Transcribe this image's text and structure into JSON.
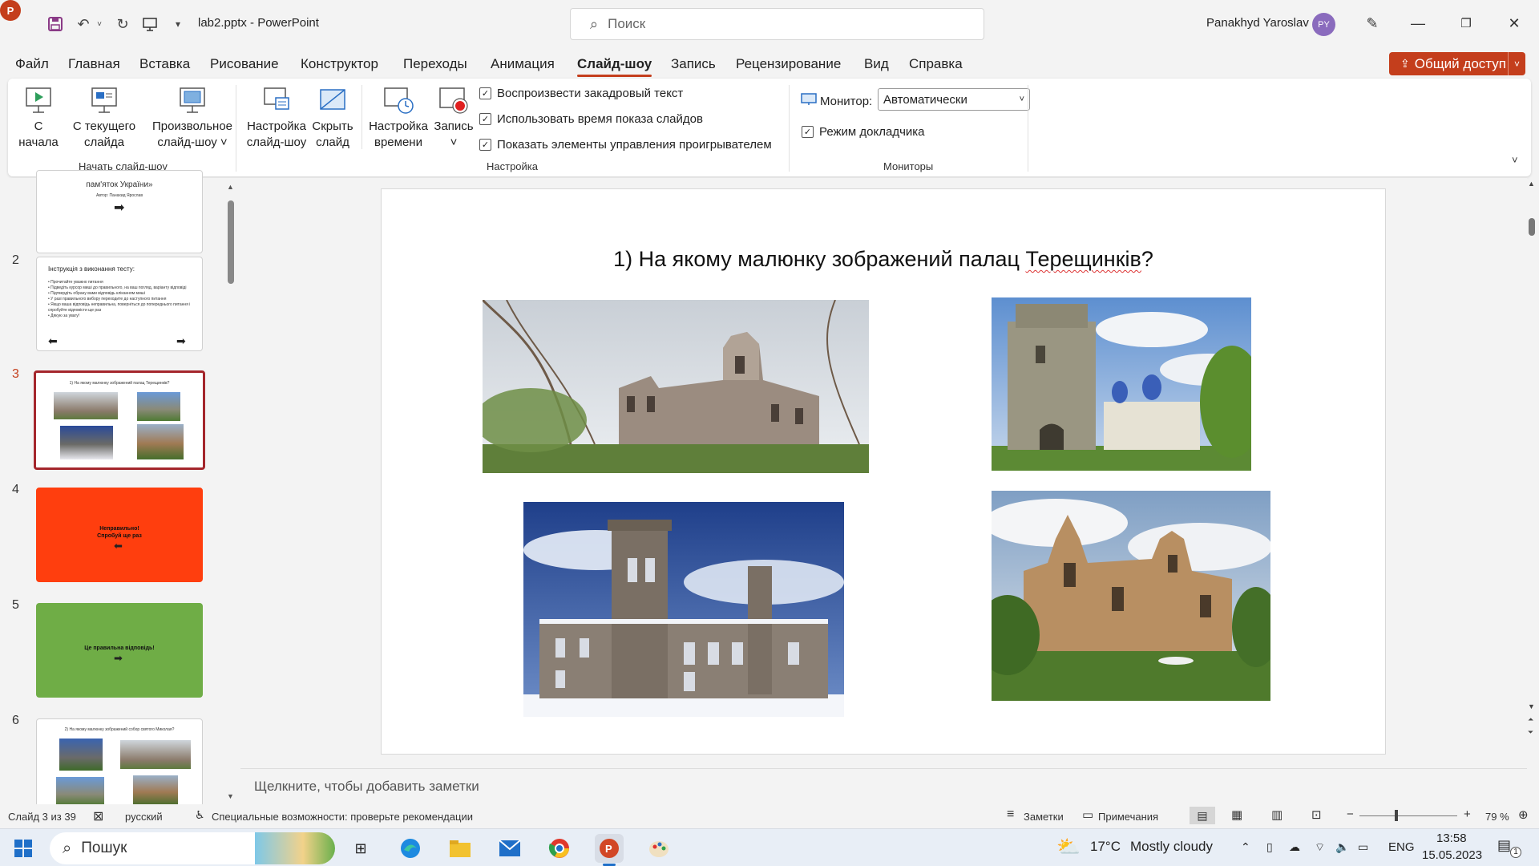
{
  "window": {
    "app_icon": "powerpoint-icon",
    "doc_title": "lab2.pptx  -  PowerPoint",
    "search_placeholder": "Поиск",
    "user_name": "Panakhyd Yaroslav",
    "user_initials": "PY"
  },
  "menu": {
    "tabs": [
      "Файл",
      "Главная",
      "Вставка",
      "Рисование",
      "Конструктор",
      "Переходы",
      "Анимация",
      "Слайд-шоу",
      "Запись",
      "Рецензирование",
      "Вид",
      "Справка"
    ],
    "active_tab": "Слайд-шоу",
    "share_label": "Общий доступ"
  },
  "ribbon": {
    "start_group": {
      "label": "Начать слайд-шоу",
      "from_start": [
        "С",
        "начала"
      ],
      "from_current": [
        "С текущего",
        "слайда"
      ],
      "custom": [
        "Произвольное",
        "слайд-шоу ˅"
      ]
    },
    "setup_group": {
      "label": "Настройка",
      "setup_show": [
        "Настройка",
        "слайд-шоу"
      ],
      "hide_slide": [
        "Скрыть",
        "слайд"
      ],
      "rehearse": [
        "Настройка",
        "времени"
      ],
      "record": [
        "Запись",
        "˅"
      ],
      "checkbox_narration": "Воспроизвести закадровый текст",
      "checkbox_timings": "Использовать время показа слайдов",
      "checkbox_controls": "Показать элементы управления проигрывателем"
    },
    "monitors_group": {
      "label": "Мониторы",
      "monitor_label": "Монитор:",
      "monitor_value": "Автоматически",
      "presenter_view": "Режим докладчика"
    }
  },
  "thumbnails": {
    "slide1_text": "пам'яток України»",
    "slide1_author": "Автор: Панахид Ярослав",
    "slide2_title": "Інструкція з виконання тесту:",
    "slide2_bullets": [
      "• Прочитайте уважно питання",
      "• Підведіть курсор миші до правильного, на ваш погляд, варіанту відповіді",
      "• Підтвердіть обрану вами відповідь кліканням миші",
      "• У разі правильного вибору переходите до наступного питання",
      "• Якщо ваша відповідь неправильна, поверніться до попереднього питання і спробуйте відповісти ще раз",
      "• Дякую за увагу!"
    ],
    "slide3_title": "1) На якому малюнку зображений палац Терещинків?",
    "slide4_text": "Неправильно! Спробуй ще раз",
    "slide5_text": "Це правильна відповідь!",
    "slide6_title": "2) На якому малюнку зображений собор святого Миколая?",
    "numbers": [
      "2",
      "3",
      "4",
      "5",
      "6"
    ],
    "active_number": "3",
    "colors": {
      "wrong": "#ff3e0e",
      "correct": "#6fad46",
      "active_border": "#a4262c"
    }
  },
  "slide": {
    "title_prefix": "1) На якому малюнку зображений палац ",
    "title_misspelled": "Терещинків",
    "title_suffix": "?",
    "photos": [
      "baroque-church-ruin-photo",
      "bell-tower-church-photo",
      "gothic-palace-winter-photo",
      "ruined-church-photo"
    ]
  },
  "notes_placeholder": "Щелкните, чтобы добавить заметки",
  "status": {
    "slide_counter": "Слайд 3 из 39",
    "language": "русский",
    "accessibility": "Специальные возможности: проверьте рекомендации",
    "notes_label": "Заметки",
    "comments_label": "Примечания",
    "zoom": "79 %"
  },
  "taskbar": {
    "search_label": "Пошук",
    "weather_temp": "17°C",
    "weather_text": "Mostly cloudy",
    "lang": "ENG",
    "time": "13:58",
    "date": "15.05.2023",
    "notif_count": "1"
  }
}
